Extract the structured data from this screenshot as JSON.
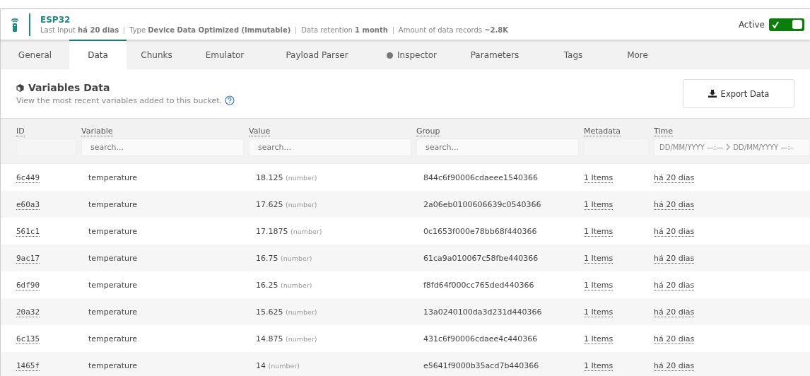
{
  "device": {
    "name": "ESP32",
    "active_label": "Active",
    "active": true,
    "meta": [
      "Last Input **há 20 dias**",
      "Type **Device Data Optimized (Immutable)**",
      "Data retention **1 month**",
      "Amount of data records **~2.8K**"
    ]
  },
  "tabs": [
    {
      "label": "General",
      "selected": false
    },
    {
      "label": "Data",
      "selected": true
    },
    {
      "label": "Chunks",
      "selected": false
    },
    {
      "label": "Emulator",
      "selected": false
    },
    {
      "label": "Payload Parser",
      "selected": false
    },
    {
      "label": "Inspector",
      "selected": false,
      "dot": true
    },
    {
      "label": "Parameters",
      "selected": false
    },
    {
      "label": "Tags",
      "selected": false
    },
    {
      "label": "More",
      "selected": false
    }
  ],
  "section": {
    "title": "Variables Data",
    "subtitle": "View the most recent variables added to this bucket.",
    "export_button": "Export Data"
  },
  "table": {
    "columns": [
      {
        "label": "ID",
        "kind": "blank"
      },
      {
        "label": "Variable",
        "kind": "search",
        "placeholder": "search..."
      },
      {
        "label": "Value",
        "kind": "search",
        "placeholder": "search..."
      },
      {
        "label": "Group",
        "kind": "search",
        "placeholder": "search..."
      },
      {
        "label": "Metadata",
        "kind": "blank"
      },
      {
        "label": "Time",
        "kind": "range",
        "from": "DD/MM/YYYY —:—",
        "to": "DD/MM/YYYY —:–"
      }
    ],
    "rows": [
      {
        "id": "6c449",
        "variable": "temperature",
        "value": "18.125",
        "type": "(number)",
        "group": "844c6f90006cdaeee1540366",
        "metadata": "1 Items",
        "time": "há 20 dias"
      },
      {
        "id": "e60a3",
        "variable": "temperature",
        "value": "17.625",
        "type": "(number)",
        "group": "2a06eb0100606639c0540366",
        "metadata": "1 Items",
        "time": "há 20 dias"
      },
      {
        "id": "561c1",
        "variable": "temperature",
        "value": "17.1875",
        "type": "(number)",
        "group": "0c1653f000e78bb68f440366",
        "metadata": "1 Items",
        "time": "há 20 dias"
      },
      {
        "id": "9ac17",
        "variable": "temperature",
        "value": "16.75",
        "type": "(number)",
        "group": "61ca9a010067c58fbe440366",
        "metadata": "1 Items",
        "time": "há 20 dias"
      },
      {
        "id": "6df90",
        "variable": "temperature",
        "value": "16.25",
        "type": "(number)",
        "group": "f8fd64f000cc765ded440366",
        "metadata": "1 Items",
        "time": "há 20 dias"
      },
      {
        "id": "20a32",
        "variable": "temperature",
        "value": "15.625",
        "type": "(number)",
        "group": "13a0240100da3d231d440366",
        "metadata": "1 Items",
        "time": "há 20 dias"
      },
      {
        "id": "6c135",
        "variable": "temperature",
        "value": "14.875",
        "type": "(number)",
        "group": "431c6f90006cdaee4c440366",
        "metadata": "1 Items",
        "time": "há 20 dias"
      },
      {
        "id": "1465f",
        "variable": "temperature",
        "value": "14",
        "type": "(number)",
        "group": "e5641f9000b35acd7b440366",
        "metadata": "1 Items",
        "time": "há 20 dias"
      }
    ]
  }
}
